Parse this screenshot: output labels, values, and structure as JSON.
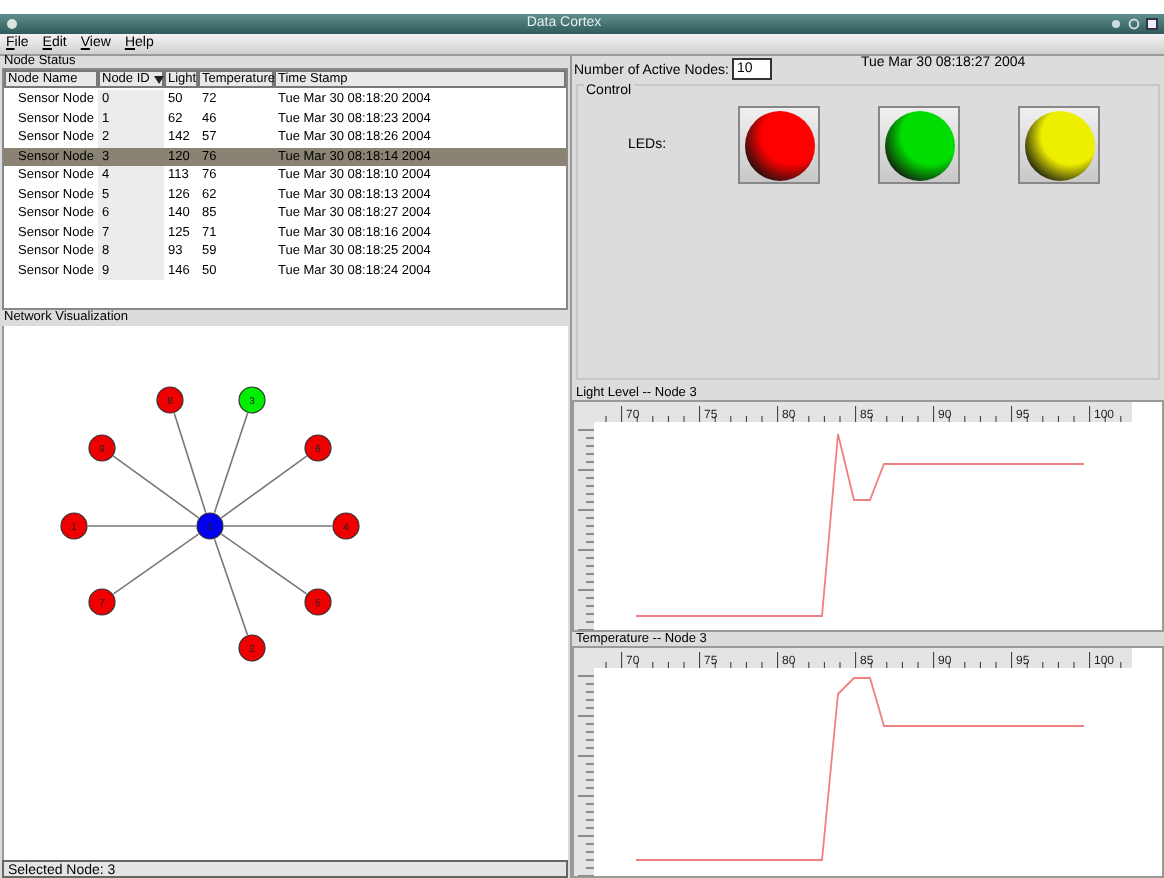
{
  "window": {
    "title": "Data Cortex"
  },
  "menu": [
    "File",
    "Edit",
    "View",
    "Help"
  ],
  "node_status": {
    "title": "Node Status",
    "columns": [
      {
        "label": "Node Name",
        "sorted": false
      },
      {
        "label": "Node ID",
        "sorted": true
      },
      {
        "label": "Light",
        "sorted": false
      },
      {
        "label": "Temperature",
        "sorted": false
      },
      {
        "label": "Time Stamp",
        "sorted": false
      }
    ],
    "rows": [
      {
        "cells": [
          "Sensor Node",
          "0",
          "50",
          "72",
          "Tue Mar 30 08:18:20 2004"
        ],
        "selected": false
      },
      {
        "cells": [
          "Sensor Node",
          "1",
          "62",
          "46",
          "Tue Mar 30 08:18:23 2004"
        ],
        "selected": false
      },
      {
        "cells": [
          "Sensor Node",
          "2",
          "142",
          "57",
          "Tue Mar 30 08:18:26 2004"
        ],
        "selected": false
      },
      {
        "cells": [
          "Sensor Node",
          "3",
          "120",
          "76",
          "Tue Mar 30 08:18:14 2004"
        ],
        "selected": true
      },
      {
        "cells": [
          "Sensor Node",
          "4",
          "113",
          "76",
          "Tue Mar 30 08:18:10 2004"
        ],
        "selected": false
      },
      {
        "cells": [
          "Sensor Node",
          "5",
          "126",
          "62",
          "Tue Mar 30 08:18:13 2004"
        ],
        "selected": false
      },
      {
        "cells": [
          "Sensor Node",
          "6",
          "140",
          "85",
          "Tue Mar 30 08:18:27 2004"
        ],
        "selected": false
      },
      {
        "cells": [
          "Sensor Node",
          "7",
          "125",
          "71",
          "Tue Mar 30 08:18:16 2004"
        ],
        "selected": false
      },
      {
        "cells": [
          "Sensor Node",
          "8",
          "93",
          "59",
          "Tue Mar 30 08:18:25 2004"
        ],
        "selected": false
      },
      {
        "cells": [
          "Sensor Node",
          "9",
          "146",
          "50",
          "Tue Mar 30 08:18:24 2004"
        ],
        "selected": false
      }
    ]
  },
  "network": {
    "title": "Network Visualization",
    "hub": {
      "label": "0"
    },
    "nodes": [
      {
        "label": "8",
        "selected": false
      },
      {
        "label": "3",
        "selected": true
      },
      {
        "label": "6",
        "selected": false
      },
      {
        "label": "4",
        "selected": false
      },
      {
        "label": "5",
        "selected": false
      },
      {
        "label": "2",
        "selected": false
      },
      {
        "label": "7",
        "selected": false
      },
      {
        "label": "1",
        "selected": false
      },
      {
        "label": "9",
        "selected": false
      }
    ]
  },
  "status_bar": "Selected Node: 3",
  "active_nodes": {
    "label": "Number of Active Nodes:",
    "value": "10"
  },
  "clock": "Tue Mar 30 08:18:27 2004",
  "control": {
    "title": "Control",
    "leds_label": "LEDs:",
    "leds": [
      {
        "color": "#ff0000"
      },
      {
        "color": "#00dd00"
      },
      {
        "color": "#eeee00"
      }
    ]
  },
  "charts": [
    {
      "title": "Light Level -- Node 3",
      "xticks": [
        "70",
        "75",
        "80",
        "85",
        "90",
        "95",
        "100"
      ]
    },
    {
      "title": "Temperature -- Node 3",
      "xticks": [
        "70",
        "75",
        "80",
        "85",
        "90",
        "95",
        "100"
      ]
    }
  ]
}
